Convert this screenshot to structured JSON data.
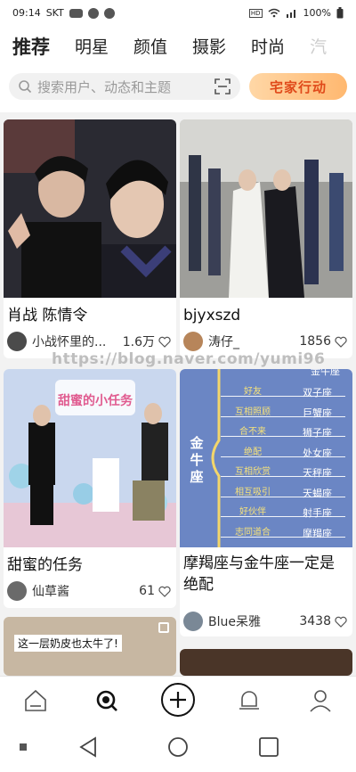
{
  "status": {
    "time": "09:14",
    "carrier": "SKT",
    "battery": "100%"
  },
  "tabs": [
    "推荐",
    "明星",
    "颜值",
    "摄影",
    "时尚",
    "汽"
  ],
  "search": {
    "placeholder": "搜索用户、动态和主题"
  },
  "promo": {
    "label": "宅家行动"
  },
  "watermark": "https://blog.naver.com/yumi96",
  "cards": [
    {
      "title": "肖战 陈情令",
      "author": "小战怀里的...",
      "likes": "1.6万"
    },
    {
      "title": "bjyxszd",
      "author": "涛仔_",
      "likes": "1856"
    },
    {
      "title": "甜蜜的任务",
      "author": "仙草酱",
      "likes": "61",
      "overlay": "甜蜜的小任务"
    },
    {
      "title": "摩羯座与金牛座一定是绝配",
      "author": "Blue呆雅",
      "likes": "3438"
    },
    {
      "caption": "这一层奶皮也太牛了!"
    }
  ],
  "chart_card": {
    "center_label": "金牛座",
    "rows": [
      {
        "relation": "好友",
        "sign": "双子座"
      },
      {
        "relation": "互相照顾",
        "sign": "巨蟹座"
      },
      {
        "relation": "合不来",
        "sign": "狮子座"
      },
      {
        "relation": "绝配",
        "sign": "处女座"
      },
      {
        "relation": "互相欣赏",
        "sign": "天秤座"
      },
      {
        "relation": "相互吸引",
        "sign": "天蝎座"
      },
      {
        "relation": "好伙伴",
        "sign": "射手座"
      },
      {
        "relation": "志同道合",
        "sign": "摩羯座"
      }
    ],
    "top_sign": "金牛座"
  },
  "colors": {
    "accent": "#c9905a",
    "chart_bg": "#6b86c4"
  }
}
